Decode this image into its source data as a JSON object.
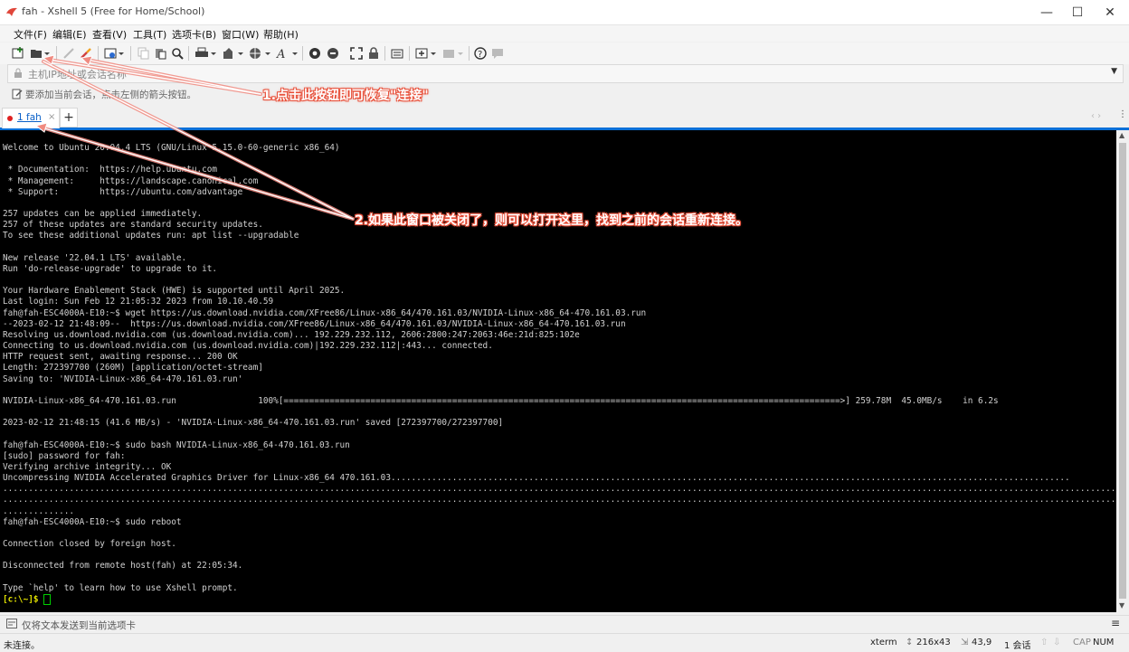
{
  "window": {
    "title": "fah - Xshell 5 (Free for Home/School)",
    "minimize": "—",
    "maximize": "☐",
    "close": "✕"
  },
  "menu": [
    "文件(F)",
    "编辑(E)",
    "查看(V)",
    "工具(T)",
    "选项卡(B)",
    "窗口(W)",
    "帮助(H)"
  ],
  "address": {
    "placeholder": "主机IP地址或会话名称"
  },
  "hint": "要添加当前会话，点击左侧的箭头按钮。",
  "tabs": [
    {
      "label": "1 fah",
      "close": "×"
    }
  ],
  "new_tab": "+",
  "terminal": {
    "lines": [
      "Welcome to Ubuntu 20.04.4 LTS (GNU/Linux 5.15.0-60-generic x86_64)",
      "",
      " * Documentation:  https://help.ubuntu.com",
      " * Management:     https://landscape.canonical.com",
      " * Support:        https://ubuntu.com/advantage",
      "",
      "257 updates can be applied immediately.",
      "257 of these updates are standard security updates.",
      "To see these additional updates run: apt list --upgradable",
      "",
      "New release '22.04.1 LTS' available.",
      "Run 'do-release-upgrade' to upgrade to it.",
      "",
      "Your Hardware Enablement Stack (HWE) is supported until April 2025.",
      "Last login: Sun Feb 12 21:05:32 2023 from 10.10.40.59",
      "fah@fah-ESC4000A-E10:~$ wget https://us.download.nvidia.com/XFree86/Linux-x86_64/470.161.03/NVIDIA-Linux-x86_64-470.161.03.run",
      "--2023-02-12 21:48:09--  https://us.download.nvidia.com/XFree86/Linux-x86_64/470.161.03/NVIDIA-Linux-x86_64-470.161.03.run",
      "Resolving us.download.nvidia.com (us.download.nvidia.com)... 192.229.232.112, 2606:2800:247:2063:46e:21d:825:102e",
      "Connecting to us.download.nvidia.com (us.download.nvidia.com)|192.229.232.112|:443... connected.",
      "HTTP request sent, awaiting response... 200 OK",
      "Length: 272397700 (260M) [application/octet-stream]",
      "Saving to: 'NVIDIA-Linux-x86_64-470.161.03.run'",
      "",
      "NVIDIA-Linux-x86_64-470.161.03.run                100%[=============================================================================================================>] 259.78M  45.0MB/s    in 6.2s",
      "",
      "2023-02-12 21:48:15 (41.6 MB/s) - 'NVIDIA-Linux-x86_64-470.161.03.run' saved [272397700/272397700]",
      "",
      "fah@fah-ESC4000A-E10:~$ sudo bash NVIDIA-Linux-x86_64-470.161.03.run",
      "[sudo] password for fah:",
      "Verifying archive integrity... OK",
      "Uncompressing NVIDIA Accelerated Graphics Driver for Linux-x86_64 470.161.03.....................................................................................................................................",
      "....................................................................................................................................................................................................................................................",
      "....................................................................................................................................................................................................................................................",
      "..............",
      "fah@fah-ESC4000A-E10:~$ sudo reboot",
      "",
      "Connection closed by foreign host.",
      "",
      "Disconnected from remote host(fah) at 22:05:34.",
      "",
      "Type `help' to learn how to use Xshell prompt."
    ],
    "prompt": "[c:\\~]$ "
  },
  "annotations": {
    "callout1": "1.点击此按钮即可恢复\"连接\"",
    "callout2": "2.如果此窗口被关闭了，则可以打开这里，找到之前的会话重新连接。"
  },
  "composer": "仅将文本发送到当前选项卡",
  "status": {
    "left": "未连接。",
    "term": "xterm",
    "size": "216x43",
    "pos": "43,9",
    "sessions": "1 会话",
    "cap": "CAP",
    "num": "NUM"
  },
  "colors": {
    "accent": "#0a70d8",
    "callout": "#e8503a",
    "prompt": "#e0e000",
    "cursor": "#00d000"
  }
}
